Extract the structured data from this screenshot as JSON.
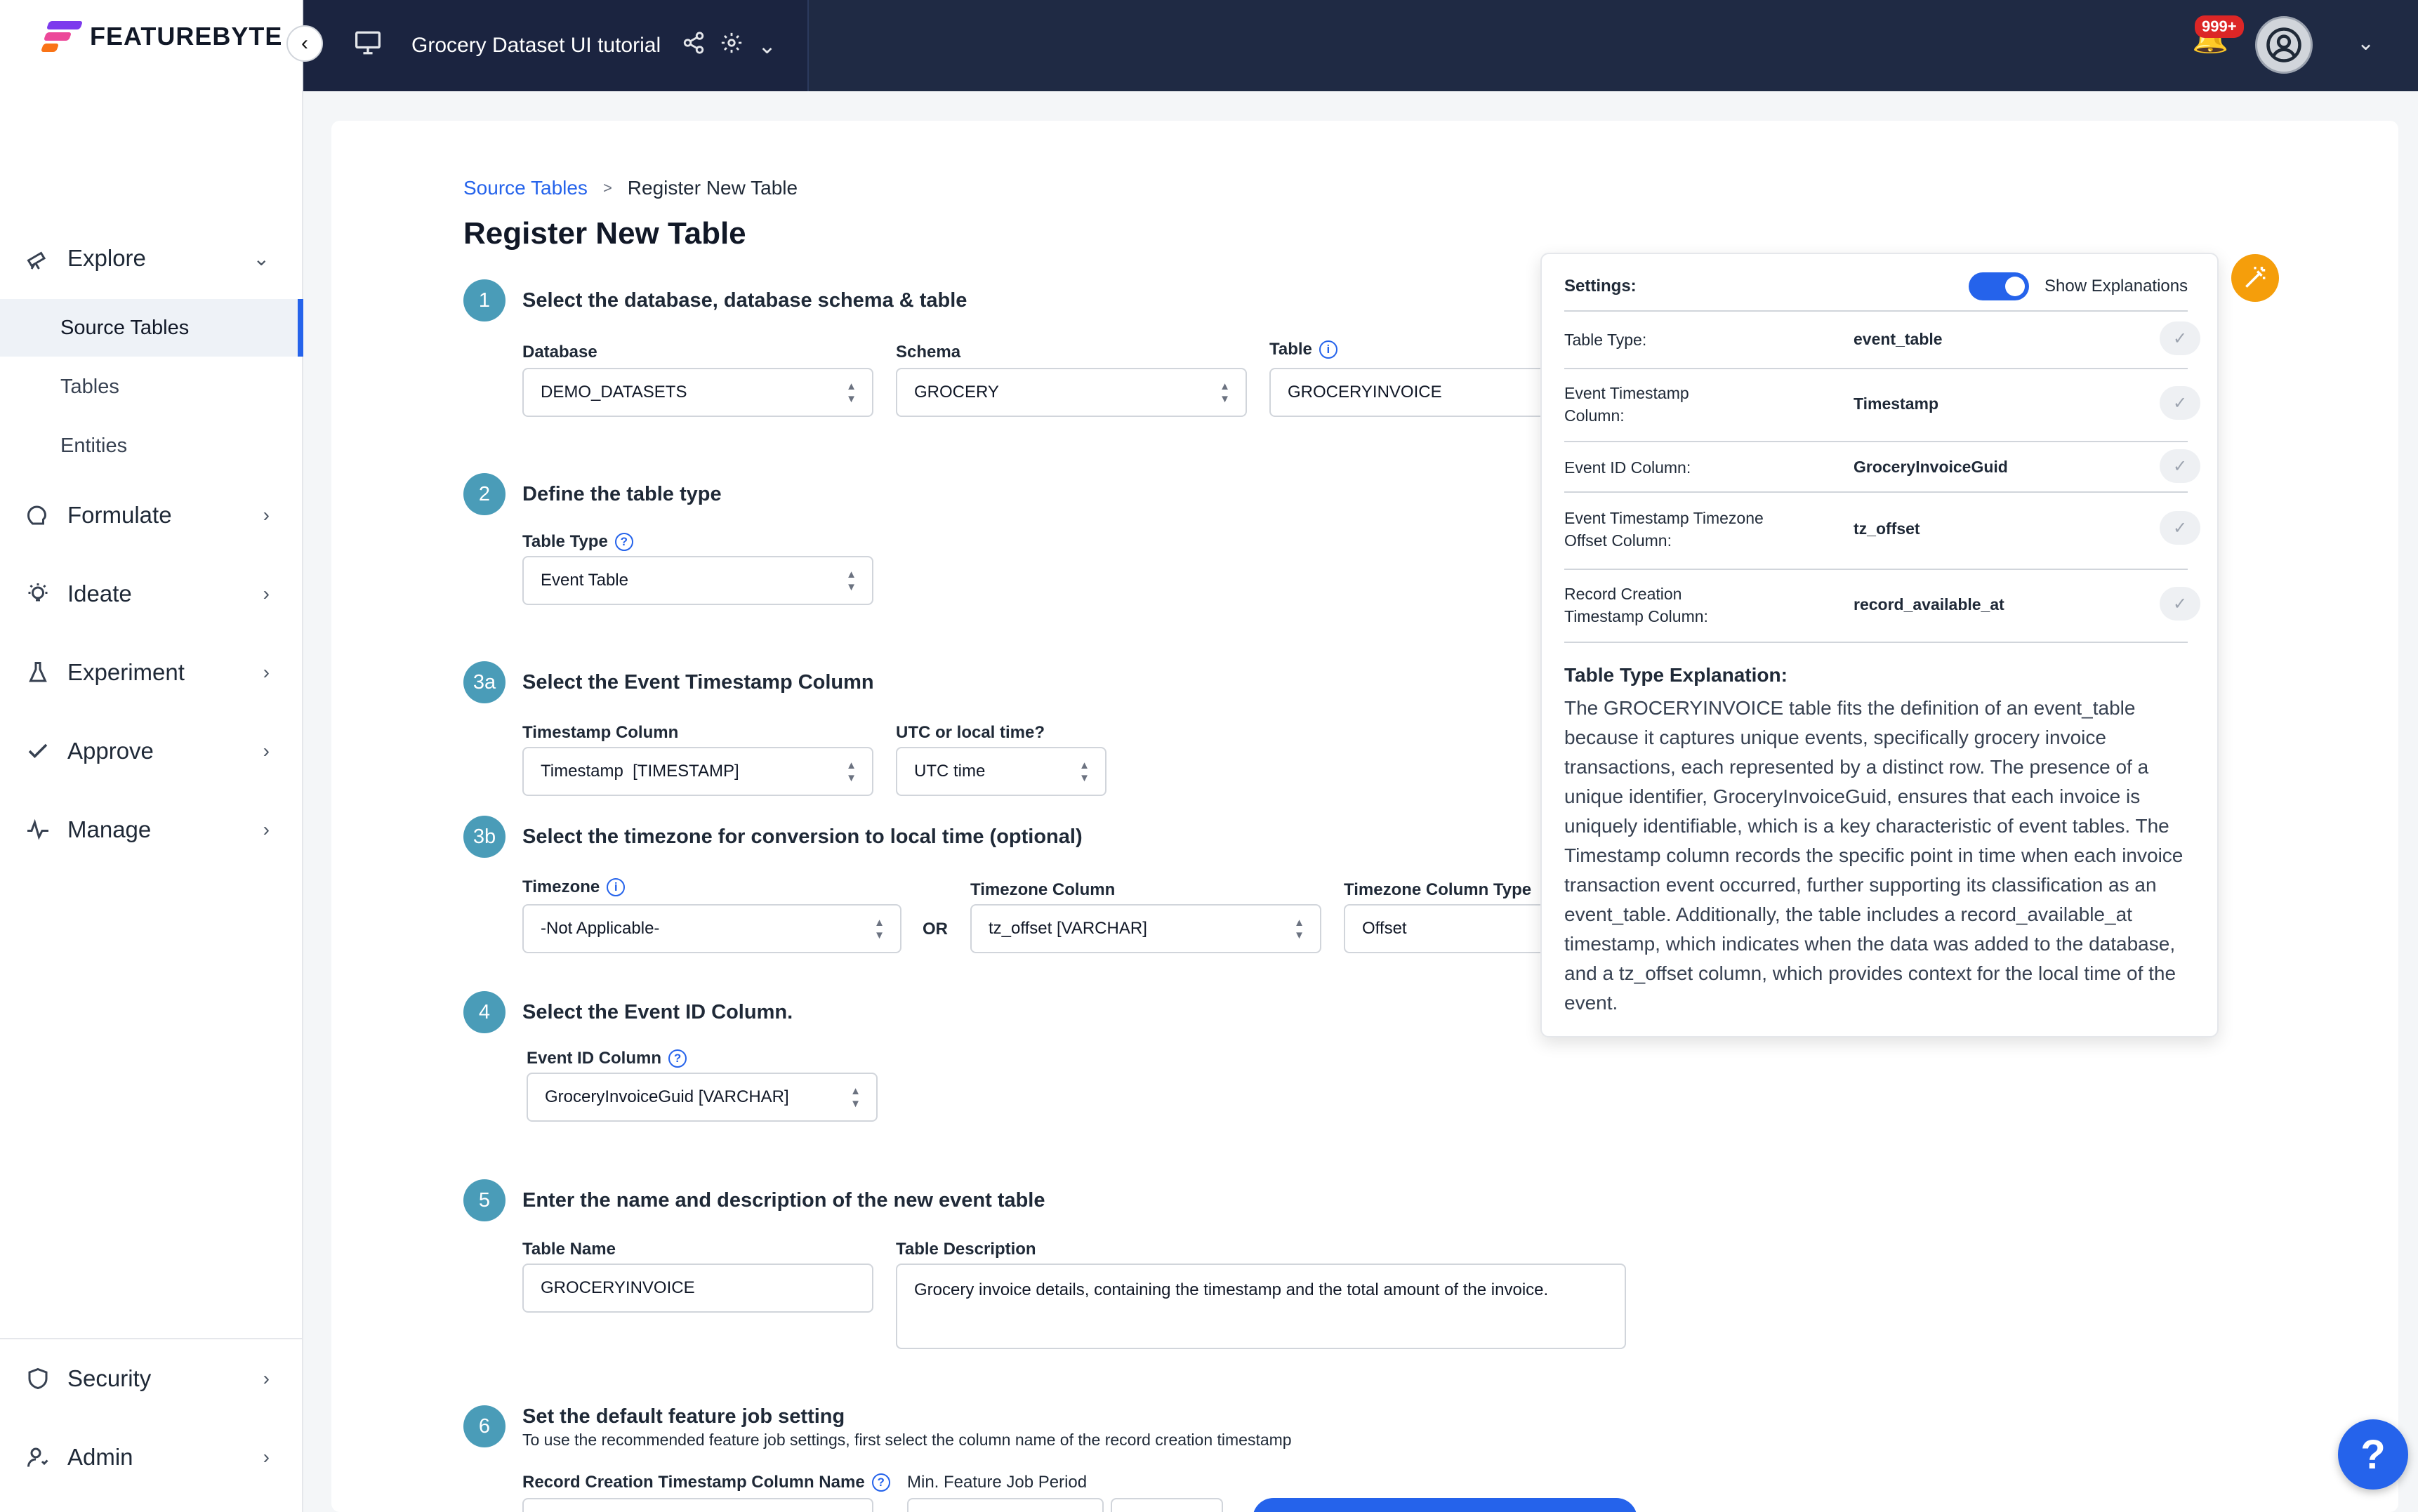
{
  "brand": {
    "name": "FEATUREBYTE"
  },
  "header": {
    "workspace_title": "Grocery Dataset UI tutorial",
    "notifications_count": "999+"
  },
  "sidebar": {
    "explore": "Explore",
    "source_tables": "Source Tables",
    "tables": "Tables",
    "entities": "Entities",
    "formulate": "Formulate",
    "ideate": "Ideate",
    "experiment": "Experiment",
    "approve": "Approve",
    "manage": "Manage",
    "security": "Security",
    "admin": "Admin"
  },
  "breadcrumb": {
    "root": "Source Tables",
    "separator": ">",
    "current": "Register New Table"
  },
  "page": {
    "title": "Register New Table"
  },
  "steps": {
    "s1": {
      "num": "1",
      "title": "Select the database, database schema & table",
      "database_label": "Database",
      "database_value": "DEMO_DATASETS",
      "schema_label": "Schema",
      "schema_value": "GROCERY",
      "table_label": "Table",
      "table_value": "GROCERYINVOICE"
    },
    "s2": {
      "num": "2",
      "title": "Define the table type",
      "type_label": "Table Type",
      "type_value": "Event Table"
    },
    "s3a": {
      "num": "3a",
      "title": "Select the Event Timestamp Column",
      "ts_label": "Timestamp Column",
      "ts_value": "Timestamp  [TIMESTAMP]",
      "utc_label": "UTC or local time?",
      "utc_value": "UTC time"
    },
    "s3b": {
      "num": "3b",
      "title": "Select the timezone for conversion to local time (optional)",
      "tz_label": "Timezone",
      "tz_value": "-Not Applicable-",
      "or": "OR",
      "tzcol_label": "Timezone Column",
      "tzcol_value": "tz_offset [VARCHAR]",
      "tztype_label": "Timezone Column Type",
      "tztype_value": "Offset"
    },
    "s4": {
      "num": "4",
      "title": "Select the Event ID Column.",
      "eid_label": "Event ID Column",
      "eid_value": "GroceryInvoiceGuid [VARCHAR]"
    },
    "s5": {
      "num": "5",
      "title": "Enter the name and description of the new event table",
      "name_label": "Table Name",
      "name_value": "GROCERYINVOICE",
      "desc_label": "Table Description",
      "desc_value": "Grocery invoice details, containing the timestamp and the total amount of the invoice."
    },
    "s6": {
      "num": "6",
      "title": "Set the default feature job setting",
      "subtitle": "To use the recommended feature job settings, first select the column name of the record creation timestamp",
      "rc_label": "Record Creation Timestamp Column Name",
      "mfjp_label": "Min. Feature Job Period"
    }
  },
  "panel": {
    "settings_label": "Settings:",
    "show_explanations": "Show Explanations",
    "rows": [
      {
        "key": "Table Type:",
        "value": "event_table"
      },
      {
        "key": "Event Timestamp Column:",
        "value": "Timestamp"
      },
      {
        "key": "Event ID Column:",
        "value": "GroceryInvoiceGuid"
      },
      {
        "key": "Event Timestamp Timezone Offset Column:",
        "value": "tz_offset"
      },
      {
        "key": "Record Creation Timestamp Column:",
        "value": "record_available_at"
      }
    ],
    "explanation_title": "Table Type Explanation:",
    "explanation_body": "The GROCERYINVOICE table fits the definition of an event_table because it captures unique events, specifically grocery invoice transactions, each represented by a distinct row. The presence of a unique identifier, GroceryInvoiceGuid, ensures that each invoice is uniquely identifiable, which is a key characteristic of event tables. The Timestamp column records the specific point in time when each invoice transaction event occurred, further supporting its classification as an event_table. Additionally, the table includes a record_available_at timestamp, which indicates when the data was added to the database, and a tz_offset column, which provides context for the local time of the event."
  },
  "help": {
    "label": "?"
  },
  "colors": {
    "accent": "#2563eb",
    "step": "#4a9cb8",
    "topbar": "#1f2a44",
    "warning": "#f59e0b"
  }
}
